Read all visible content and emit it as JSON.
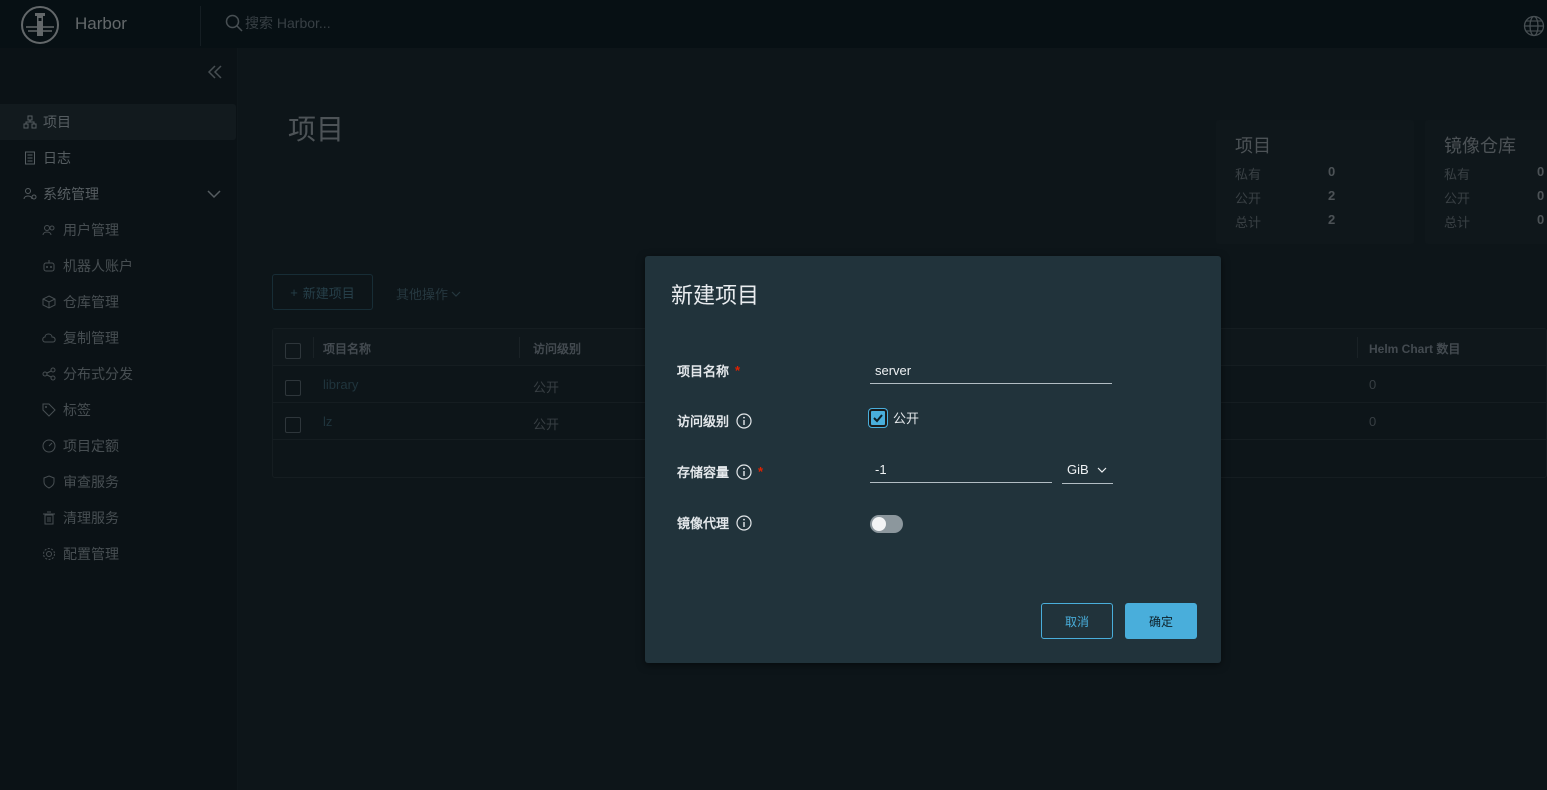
{
  "header": {
    "brand": "Harbor",
    "search_placeholder": "搜索 Harbor..."
  },
  "sidebar": {
    "items": [
      {
        "label": "项目",
        "icon": "project-icon",
        "active": true
      },
      {
        "label": "日志",
        "icon": "log-icon"
      },
      {
        "label": "系统管理",
        "icon": "admin-icon"
      }
    ],
    "sub_items": [
      {
        "label": "用户管理",
        "icon": "users-icon"
      },
      {
        "label": "机器人账户",
        "icon": "robot-icon"
      },
      {
        "label": "仓库管理",
        "icon": "registry-icon"
      },
      {
        "label": "复制管理",
        "icon": "replication-icon"
      },
      {
        "label": "分布式分发",
        "icon": "share-icon"
      },
      {
        "label": "标签",
        "icon": "tag-icon"
      },
      {
        "label": "项目定额",
        "icon": "quota-icon"
      },
      {
        "label": "审查服务",
        "icon": "shield-icon"
      },
      {
        "label": "清理服务",
        "icon": "trash-icon"
      },
      {
        "label": "配置管理",
        "icon": "gear-icon"
      }
    ]
  },
  "main": {
    "title": "项目",
    "stats": [
      {
        "title": "项目",
        "rows": [
          {
            "label": "私有",
            "value": "0"
          },
          {
            "label": "公开",
            "value": "2"
          },
          {
            "label": "总计",
            "value": "2"
          }
        ]
      },
      {
        "title": "镜像仓库",
        "rows": [
          {
            "label": "私有",
            "value": "0"
          },
          {
            "label": "公开",
            "value": "0"
          },
          {
            "label": "总计",
            "value": "0"
          }
        ]
      }
    ],
    "new_project_button": "新建项目",
    "more_actions": "其他操作",
    "table": {
      "columns": [
        "项目名称",
        "访问级别",
        "Helm Chart 数目"
      ],
      "rows": [
        {
          "name": "library",
          "access": "公开",
          "helm": "0"
        },
        {
          "name": "lz",
          "access": "公开",
          "helm": "0"
        }
      ]
    }
  },
  "modal": {
    "title": "新建项目",
    "fields": {
      "name_label": "项目名称",
      "name_value": "server",
      "access_label": "访问级别",
      "access_checkbox_label": "公开",
      "access_checked": true,
      "storage_label": "存储容量",
      "storage_value": "-1",
      "storage_unit": "GiB",
      "proxy_label": "镜像代理",
      "proxy_enabled": false
    },
    "cancel": "取消",
    "ok": "确定"
  },
  "colors": {
    "accent": "#49aedb",
    "required": "#e02200",
    "header_bg": "#0f2029",
    "modal_bg": "#21333b"
  }
}
